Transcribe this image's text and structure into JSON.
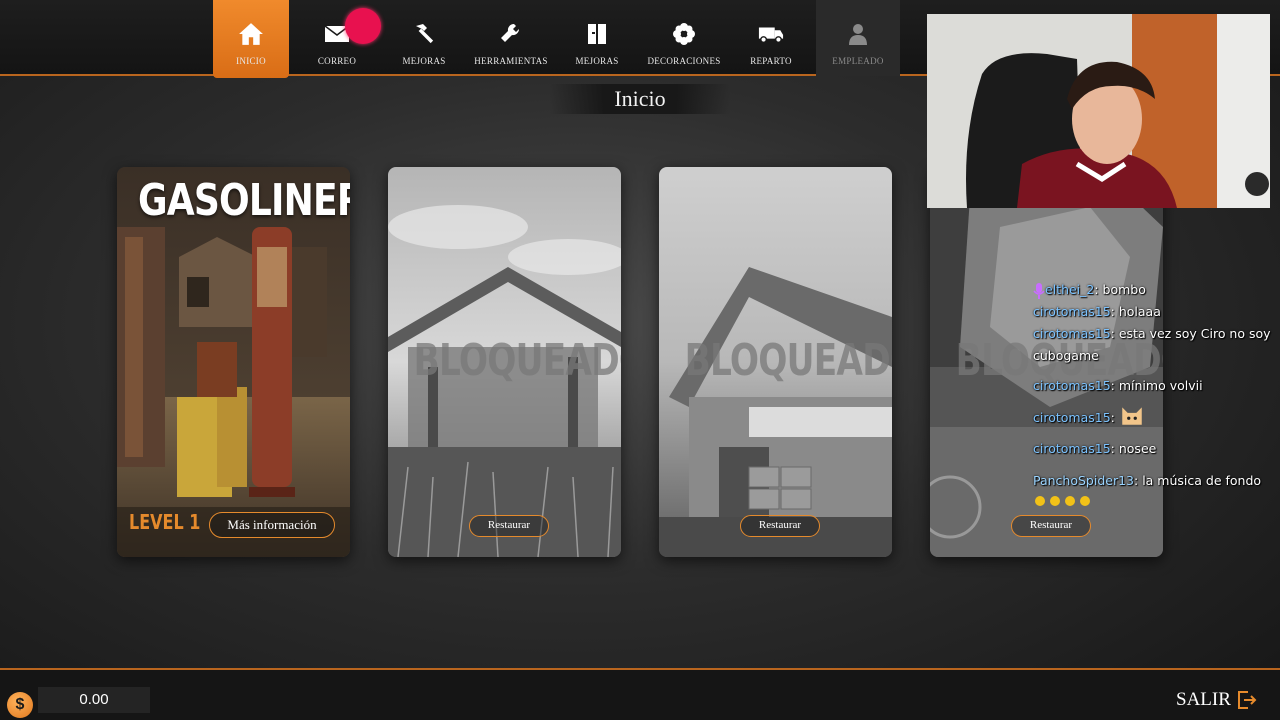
{
  "nav": {
    "items": [
      {
        "label": "INICIO",
        "icon": "home-icon"
      },
      {
        "label": "CORREO",
        "icon": "mail-icon"
      },
      {
        "label": "MEJORAS",
        "icon": "hammer-icon"
      },
      {
        "label": "HERRAMIENTAS",
        "icon": "wrench-icon"
      },
      {
        "label": "MEJORAS",
        "icon": "book-icon"
      },
      {
        "label": "DECORACIONES",
        "icon": "flower-icon"
      },
      {
        "label": "REPARTO",
        "icon": "truck-icon"
      },
      {
        "label": "EMPLEADO",
        "icon": "person-icon"
      }
    ],
    "active_color": "#e97a20"
  },
  "page_title": "Inicio",
  "cards": [
    {
      "title": "GASOLINERA",
      "level": "LEVEL 1",
      "button": "Más información",
      "locked": false
    },
    {
      "locked_text": "BLOQUEADO",
      "button": "Restaurar",
      "locked": true
    },
    {
      "locked_text": "BLOQUEADO",
      "button": "Restaurar",
      "locked": true
    },
    {
      "locked_text": "BLOQUEADO",
      "button": "Restaurar",
      "locked": true
    }
  ],
  "chat": [
    {
      "user": "elthei_2",
      "text": ": bombo"
    },
    {
      "user": "cirotomas15",
      "text": ": holaaa"
    },
    {
      "user": "cirotomas15",
      "text": ": esta vez soy Ciro no soy cubogame"
    },
    {
      "user": "cirotomas15",
      "text": ": mínimo volvii"
    },
    {
      "user": "cirotomas15",
      "text": ":"
    },
    {
      "user": "cirotomas15",
      "text": ": nosee"
    },
    {
      "user": "PanchoSpider13",
      "text": ": la música de fondo"
    }
  ],
  "footer": {
    "currency_symbol": "$",
    "balance": "0.00",
    "exit_label": "SALIR"
  },
  "colors": {
    "accent": "#e58a2c",
    "notification": "#e8114f"
  }
}
